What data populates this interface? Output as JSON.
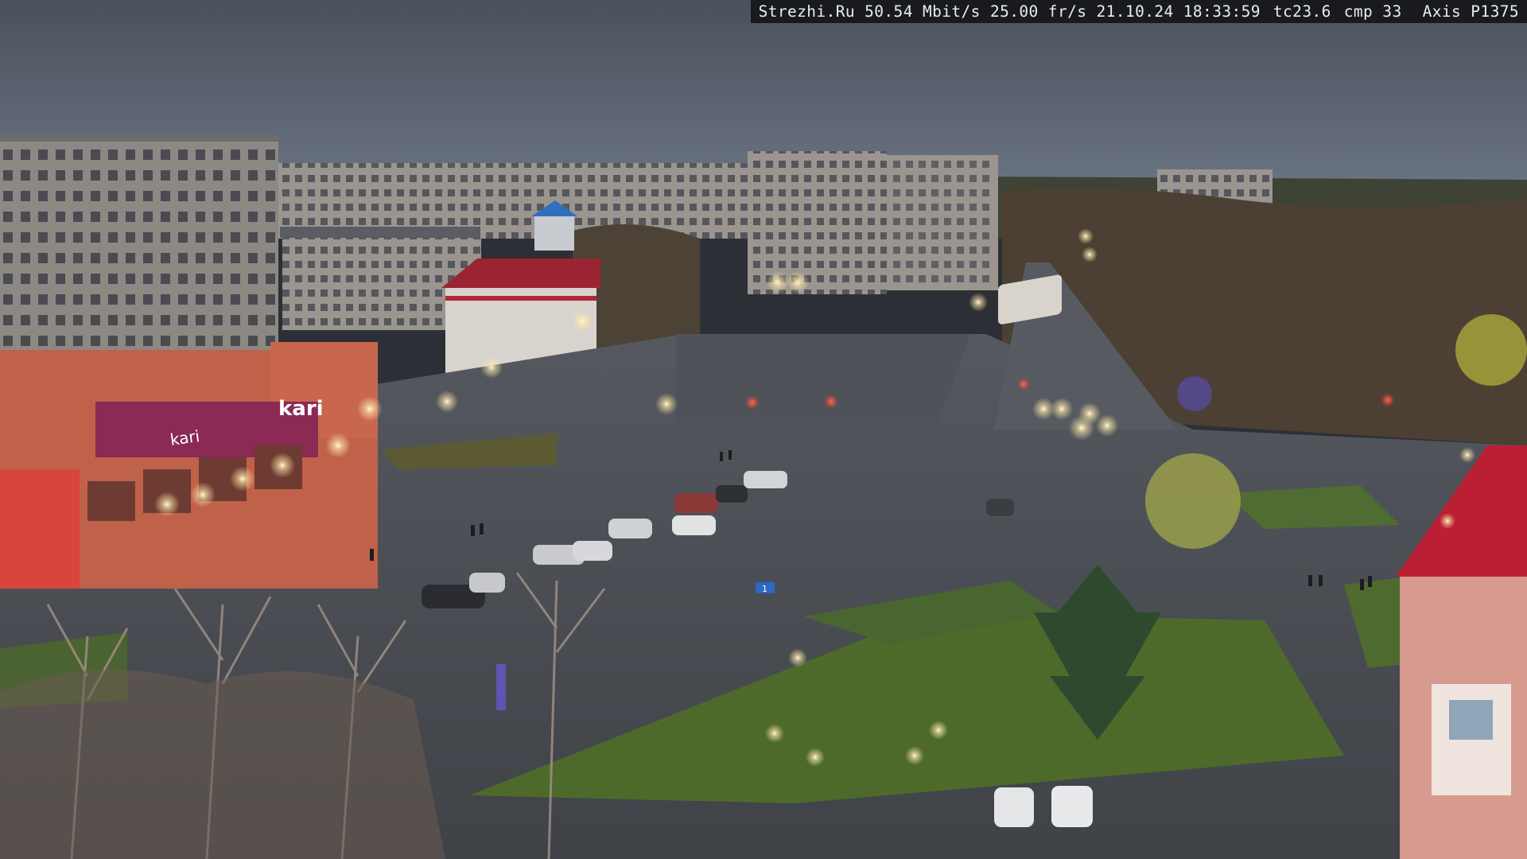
{
  "osd": {
    "site": "Strezhi.Ru",
    "bitrate": "50.54 Mbit/s",
    "framerate": "25.00 fr/s",
    "date": "21.10.24",
    "time": "18:33:59",
    "tc": "tc23.6",
    "cmp": "cmp 33",
    "camera_model": "Axis P1375"
  },
  "signs": {
    "store_logo": "kari",
    "store_banner": "kari",
    "sign_bus_stop": "1"
  },
  "colors": {
    "sky": "#5a6270",
    "asphalt": "#4c5056",
    "grass": "#4f6a2c",
    "building_left": "#8e8a86",
    "store_facade": "#c6624a",
    "store_banner": "#8a2a55",
    "roof_red": "#b41e2e"
  }
}
